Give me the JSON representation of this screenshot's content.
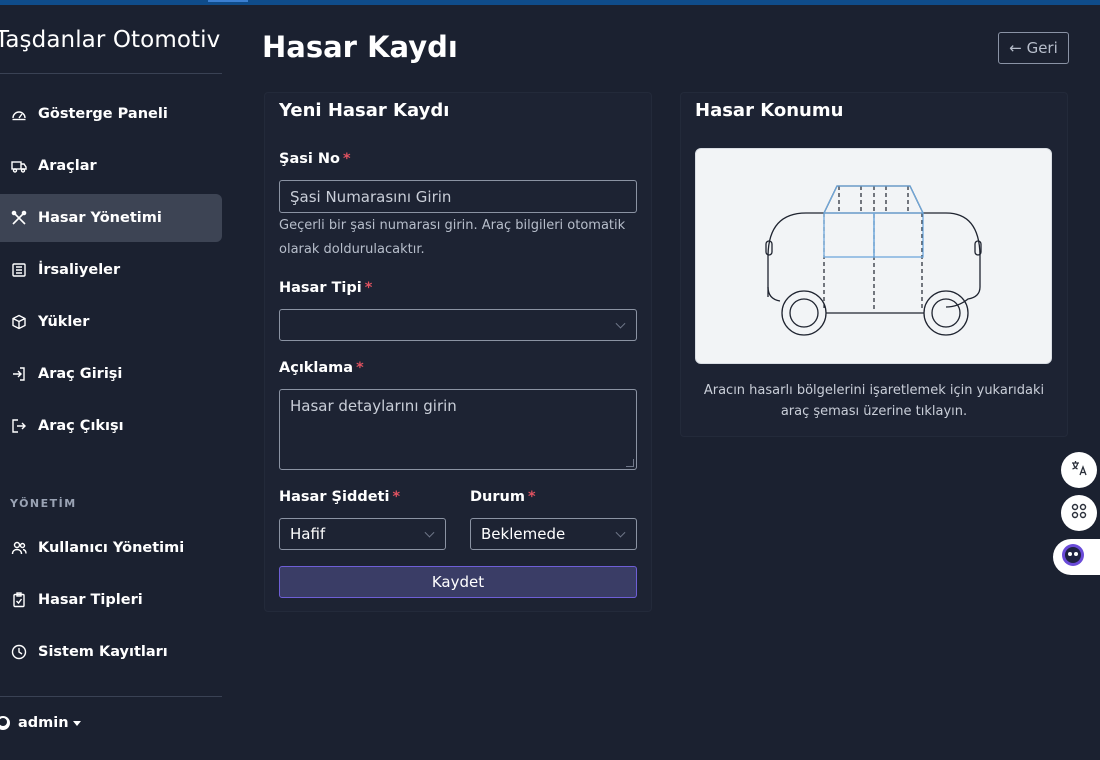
{
  "sidebar": {
    "brand": "Taşdanlar Otomotiv",
    "items": [
      {
        "label": "Gösterge Paneli",
        "icon": "gauge-icon"
      },
      {
        "label": "Araçlar",
        "icon": "truck-icon"
      },
      {
        "label": "Hasar Yönetimi",
        "icon": "tools-icon",
        "active": true
      },
      {
        "label": "İrsaliyeler",
        "icon": "list-icon"
      },
      {
        "label": "Yükler",
        "icon": "box-icon"
      },
      {
        "label": "Araç Girişi",
        "icon": "sign-in-icon"
      },
      {
        "label": "Araç Çıkışı",
        "icon": "sign-out-icon"
      }
    ],
    "section_label": "YÖNETİM",
    "admin_items": [
      {
        "label": "Kullanıcı Yönetimi",
        "icon": "users-icon"
      },
      {
        "label": "Hasar Tipleri",
        "icon": "clipboard-icon"
      },
      {
        "label": "Sistem Kayıtları",
        "icon": "clock-icon"
      }
    ],
    "user": "admin"
  },
  "header": {
    "title": "Hasar Kaydı",
    "back_label": "← Geri"
  },
  "form": {
    "title": "Yeni Hasar Kaydı",
    "chassis_label": "Şasi No",
    "chassis_placeholder": "Şasi Numarasını Girin",
    "chassis_help": "Geçerli bir şasi numarası girin. Araç bilgileri otomatik olarak doldurulacaktır.",
    "damage_type_label": "Hasar Tipi",
    "damage_type_value": "",
    "description_label": "Açıklama",
    "description_placeholder": "Hasar detaylarını girin",
    "severity_label": "Hasar Şiddeti",
    "severity_value": "Hafif",
    "status_label": "Durum",
    "status_value": "Beklemede",
    "required_mark": "*",
    "save_label": "Kaydet"
  },
  "location": {
    "title": "Hasar Konumu",
    "caption": "Aracın hasarlı bölgelerini işaretlemek için yukarıdaki araç şeması üzerine tıklayın."
  },
  "colors": {
    "background": "#1b2130",
    "accent": "#6e5fd6",
    "required": "#e05260"
  }
}
